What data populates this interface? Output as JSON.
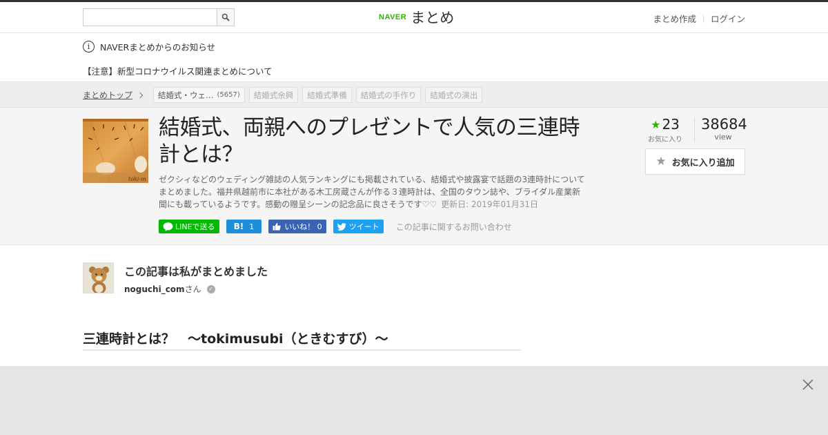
{
  "header": {
    "search": {
      "placeholder": "",
      "value": ""
    },
    "logo": {
      "naver": "NAVER",
      "matome": "まとめ"
    },
    "links": {
      "create": "まとめ作成",
      "login": "ログイン"
    }
  },
  "notice": {
    "heading": "NAVERまとめからのお知らせ",
    "link": "【注意】新型コロナウイルス関連まとめについて"
  },
  "breadcrumb": {
    "top": "まとめトップ",
    "tags": [
      {
        "label": "結婚式・ウェ…",
        "count": "(5657)"
      },
      {
        "label": "結婚式余興"
      },
      {
        "label": "結婚式準備"
      },
      {
        "label": "結婚式の手作り"
      },
      {
        "label": "結婚式の演出"
      }
    ]
  },
  "article": {
    "title": "結婚式、両親へのプレゼントで人気の三連時計とは？",
    "description": "ゼクシィなどのウェディング雑誌の人気ランキングにも掲載されている、結婚式や披露宴で話題の3連時計についてまとめました。福井県越前市に本社がある木工房蔵さんが作る３連時計は、全国のタウン誌や、ブライダル産業新聞にも載っているようです。感動の贈呈シーンの記念品に良さそうです♡♡",
    "updated": "更新日: 2019年01月31日",
    "thumb_text": "toki-m",
    "favorites": "23",
    "favorites_label": "お気に入り",
    "views": "38684",
    "views_label": "view",
    "fav_button": "お気に入り追加",
    "share": {
      "line": "LINEで送る",
      "hatena_count": "1",
      "fb": "いいね！ 0",
      "twitter": "ツイート",
      "contact": "この記事に関するお問い合わせ"
    }
  },
  "author": {
    "heading": "この記事は私がまとめました",
    "name": "noguchi_com",
    "suffix": "さん"
  },
  "section": {
    "heading": "三連時計とは？　〜tokimusubi（ときむすび）〜"
  },
  "colors": {
    "naver_green": "#2db400",
    "line_green": "#00b900",
    "hatena_blue": "#1d8ed9",
    "facebook_blue": "#3b63b3",
    "twitter_blue": "#1da1f2"
  }
}
